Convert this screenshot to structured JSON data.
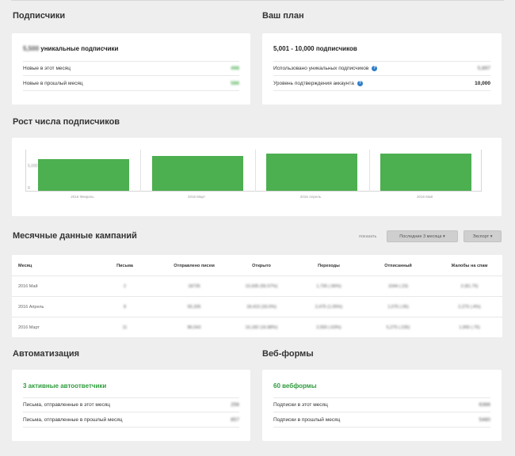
{
  "subscribers": {
    "title": "Подписчики",
    "unique_count": "5,500",
    "unique_label": "уникальные подписчики",
    "rows": [
      {
        "label": "Новые в этот месяц",
        "value": "498"
      },
      {
        "label": "Новые в прошлый месяц",
        "value": "586"
      }
    ]
  },
  "plan": {
    "title": "Ваш план",
    "head": "5,001 - 10,000 подписчиков",
    "rows": [
      {
        "label": "Использовано уникальных подписчиков",
        "value": "5,897",
        "help": "?"
      },
      {
        "label": "Уровень подтверждения аккаунта",
        "value": "10,000",
        "help": "?"
      }
    ]
  },
  "growth": {
    "title": "Рост числа подписчиков",
    "y_ticks": [
      "5,000",
      "0"
    ],
    "chart_data": {
      "type": "bar",
      "categories": [
        "2016 Февраль",
        "2016 Март",
        "2016 Апрель",
        "2016 Май"
      ],
      "values": [
        5100,
        5600,
        6000,
        6000
      ],
      "ylim": [
        0,
        6700
      ],
      "title": "",
      "xlabel": "",
      "ylabel": ""
    }
  },
  "campaigns": {
    "title": "Месячные данные кампаний",
    "show_label": "показать",
    "period_button": "Последние 3 месяца ▾",
    "export_button": "Экспорт ▾",
    "columns": [
      "Месяц",
      "Письма",
      "Отправлено писем",
      "Открыто",
      "Переходы",
      "Отписанный",
      "Жалобы на спам"
    ],
    "rows": [
      [
        "2016 Май",
        "2",
        "18735",
        "10,435 (55.57%)",
        "1,735 (.96%)",
        "1044 (.23)",
        "3 (81.75)"
      ],
      [
        "2016 Апрель",
        "8",
        "55,335",
        "18,415 (33.0%)",
        "2,475 (1.05%)",
        "1,075 (.05)",
        "2,275 (.4%)"
      ],
      [
        "2016 Март",
        "11",
        "86,543",
        "16,182 (16.88%)",
        "2,555 (.63%)",
        "5,275 (.235)",
        "1,955 (.75)"
      ]
    ]
  },
  "automation": {
    "title": "Автоматизация",
    "head": "3 активные автоответчики",
    "rows": [
      {
        "label": "Письма, отправленные в этот месяц",
        "value": "256"
      },
      {
        "label": "Письма, отправленные в прошлый месяц",
        "value": "857"
      }
    ]
  },
  "webforms": {
    "title": "Веб-формы",
    "head": "60 вебформы",
    "rows": [
      {
        "label": "Подписки в этот месяц",
        "value": "6366"
      },
      {
        "label": "Подписки в прошлый месяц",
        "value": "5480"
      }
    ]
  },
  "colors": {
    "green": "#4caf50",
    "link_green": "#2e9b3c",
    "help_blue": "#2d7ec7"
  }
}
